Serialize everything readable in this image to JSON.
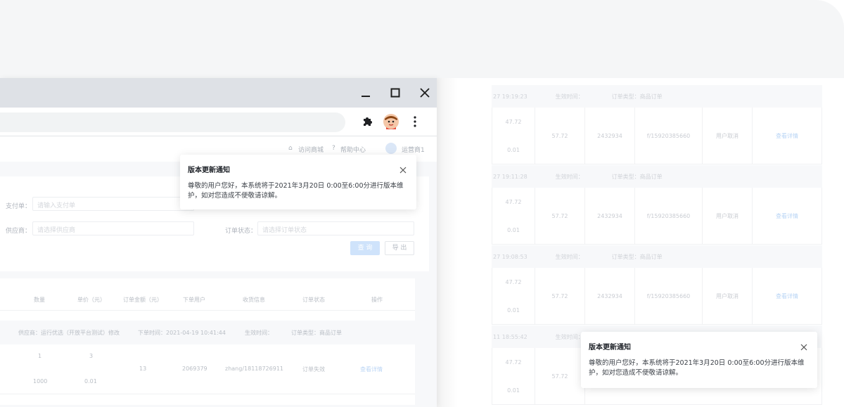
{
  "window": {
    "minimize_icon": "minimize-icon",
    "maximize_icon": "maximize-icon",
    "close_icon": "close-icon"
  },
  "toolbar": {
    "extensions_icon": "puzzle-icon",
    "profile_icon": "avatar",
    "menu_icon": "kebab-menu-icon"
  },
  "topnav": {
    "visit_mall": "访问商城",
    "help_center": "帮助中心",
    "operator": "运营商1"
  },
  "filter": {
    "payment_no_label": "支付单：",
    "payment_no_placeholder": "请输入支付单",
    "supplier_label": "供应商：",
    "supplier_placeholder": "请选择供应商",
    "order_status_label": "订单状态：",
    "order_status_placeholder": "请选择订单状态",
    "query_button": "查 询",
    "export_button": "导 出"
  },
  "table": {
    "headers": [
      "数量",
      "单价（元）",
      "订单金额（元）",
      "下单用户",
      "收货信息",
      "订单状态",
      "操作"
    ],
    "sub": {
      "supplier": "供应商：运行优选（开放平台测试）修改",
      "order_time": "下单时间：2021-04-19 10:41:44",
      "effect_time": "生效时间：",
      "order_type": "订单类型：商品订单"
    },
    "row": {
      "qty_top": "1",
      "qty_bottom": "1000",
      "price_top": "3",
      "price_bottom": "0.01",
      "amount": "13",
      "user": "2069379",
      "receiver": "zhang/18118726911",
      "status": "订单失效",
      "action": "查看详情"
    }
  },
  "right_list": {
    "blocks": [
      {
        "time": "27 19:19:23",
        "effect": "生效时间：",
        "type": "订单类型：商品订单",
        "top": "47.72",
        "bottom": "0.01",
        "amount": "57.72",
        "id": "2432934",
        "phone": "f/15920385660",
        "status": "用户取消",
        "action": "查看详情"
      },
      {
        "time": "27 19:11:28",
        "effect": "生效时间：",
        "type": "订单类型：商品订单",
        "top": "47.72",
        "bottom": "0.01",
        "amount": "57.72",
        "id": "2432934",
        "phone": "f/15920385660",
        "status": "用户取消",
        "action": "查看详情"
      },
      {
        "time": "27 19:08:53",
        "effect": "生效时间：",
        "type": "订单类型：商品订单",
        "top": "47.72",
        "bottom": "0.01",
        "amount": "57.72",
        "id": "2432934",
        "phone": "f/15920385660",
        "status": "用户取消",
        "action": "查看详情"
      },
      {
        "time": "11 18:55:42",
        "effect": "生效时间：",
        "type": "",
        "top": "47.72",
        "bottom": "0.01",
        "amount": "57.72",
        "id": "",
        "phone": "",
        "status": "",
        "action": ""
      }
    ]
  },
  "notification_main": {
    "title": "版本更新通知",
    "body": "尊敬的用户您好，本系统将于2021年3月20日 0:00至6:00分进行版本维护，如对您造成不便敬请谅解。",
    "close_icon": "close-icon"
  },
  "notification_secondary": {
    "title": "版本更新通知",
    "body": "尊敬的用户您好，本系统将于2021年3月20日 0:00至6:00分进行版本维护，如对您造成不便敬请谅解。",
    "close_icon": "close-icon"
  }
}
